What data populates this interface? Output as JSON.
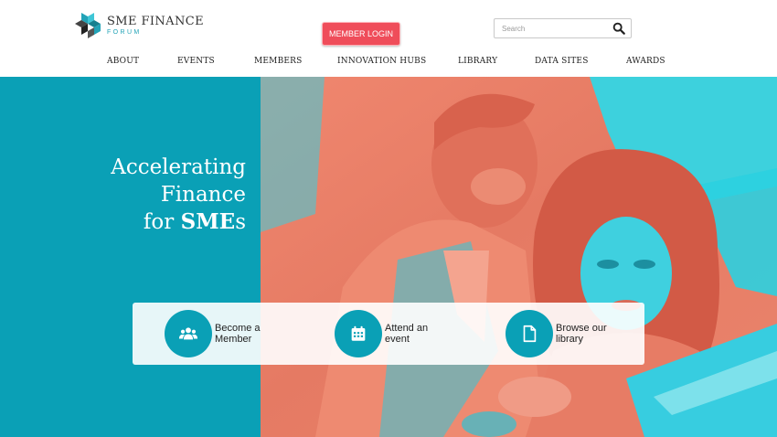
{
  "brand": {
    "name": "SME FINANCE",
    "subtitle": "FORUM",
    "colors": {
      "teal": "#0aa0b6",
      "coral": "#ef4d5a",
      "dark": "#333333"
    }
  },
  "header": {
    "login_label": "MEMBER LOGIN",
    "search": {
      "placeholder": "Search",
      "value": "",
      "icon": "search-icon"
    }
  },
  "nav": {
    "items": [
      {
        "label": "ABOUT"
      },
      {
        "label": "EVENTS"
      },
      {
        "label": "MEMBERS"
      },
      {
        "label": "INNOVATION HUBS"
      },
      {
        "label": "LIBRARY"
      },
      {
        "label": "DATA SITES"
      },
      {
        "label": "AWARDS"
      }
    ]
  },
  "hero": {
    "headline": {
      "line1": "Accelerating",
      "line2": "Finance",
      "line3_prefix": "for ",
      "line3_bold": "SME",
      "line3_suffix": "s"
    },
    "ctas": [
      {
        "line1": "Become a",
        "line2": "Member",
        "icon": "users-icon"
      },
      {
        "line1": "Attend an",
        "line2": "event",
        "icon": "calendar-icon"
      },
      {
        "line1": "Browse our",
        "line2": "library",
        "icon": "document-icon"
      }
    ]
  }
}
